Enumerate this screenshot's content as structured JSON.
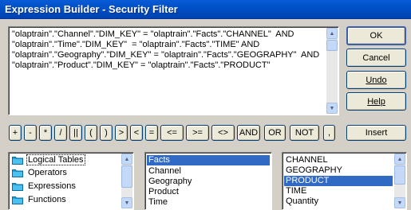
{
  "window": {
    "title": "Expression Builder - Security Filter"
  },
  "expression": {
    "lines": [
      "\"olaptrain\".\"Channel\".\"DIM_KEY\" = \"olaptrain\".\"Facts\".\"CHANNEL\"  AND",
      "\"olaptrain\".\"Time\".\"DIM_KEY\"  = \"olaptrain\".\"Facts\".\"TIME\" AND",
      "\"olaptrain\".\"Geography\".\"DIM_KEY\" = \"olaptrain\".\"Facts\".\"GEOGRAPHY\"  AND",
      "\"olaptrain\".\"Product\".\"DIM_KEY\" = \"olaptrain\".\"Facts\".\"PRODUCT\""
    ]
  },
  "buttons": {
    "ok": "OK",
    "cancel": "Cancel",
    "undo": "Undo",
    "help": "Help",
    "insert": "Insert"
  },
  "operators": [
    "+",
    "-",
    "*",
    "/",
    "||",
    "(",
    ")",
    ">",
    "<",
    "=",
    "<=",
    ">=",
    "<>",
    "AND",
    "OR",
    "NOT",
    ","
  ],
  "categories": {
    "items": [
      {
        "label": "Logical Tables",
        "icon": "folder-icon"
      },
      {
        "label": "Operators",
        "icon": "folder-icon"
      },
      {
        "label": "Expressions",
        "icon": "folder-icon"
      },
      {
        "label": "Functions",
        "icon": "folder-icon"
      }
    ],
    "selected": "Logical Tables"
  },
  "tables": {
    "items": [
      "Facts",
      "Channel",
      "Geography",
      "Product",
      "Time"
    ],
    "selected": "Facts"
  },
  "columns": {
    "items": [
      "CHANNEL",
      "GEOGRAPHY",
      "PRODUCT",
      "TIME",
      "Quantity"
    ],
    "selected": "PRODUCT"
  },
  "colors": {
    "titlebar": "#0050c8",
    "selection": "#316ac5",
    "dialog_bg": "#d4d0c8",
    "folder": "#1ea0d8"
  }
}
